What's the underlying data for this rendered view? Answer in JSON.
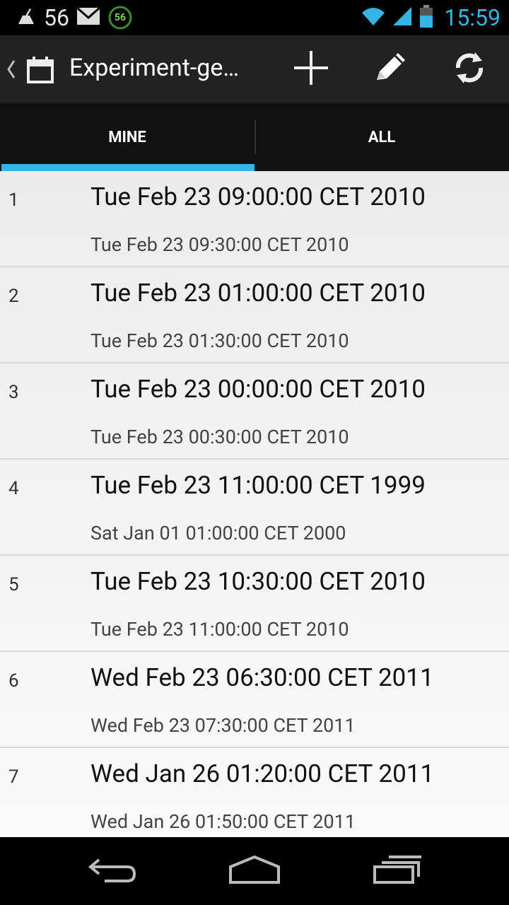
{
  "status_bar": {
    "notification_count": "56",
    "badge_count": "56",
    "time": "15:59",
    "icons": [
      "cleaner-icon",
      "mail-icon",
      "badge-icon",
      "wifi-icon",
      "signal-icon",
      "battery-icon"
    ]
  },
  "action_bar": {
    "title": "Experiment-ge…",
    "icons": [
      "up-chevron-icon",
      "calendar-icon",
      "add-icon",
      "edit-icon",
      "refresh-icon"
    ]
  },
  "tabs": [
    {
      "label": "MINE",
      "selected": true
    },
    {
      "label": "ALL",
      "selected": false
    }
  ],
  "colors": {
    "accent": "#33b5e5",
    "action_bar": "#222222",
    "tabs": "#111111"
  },
  "list": [
    {
      "index": "1",
      "primary": "Tue Feb 23 09:00:00 CET 2010",
      "secondary": "Tue Feb 23 09:30:00 CET 2010"
    },
    {
      "index": "2",
      "primary": "Tue Feb 23 01:00:00 CET 2010",
      "secondary": "Tue Feb 23 01:30:00 CET 2010"
    },
    {
      "index": "3",
      "primary": "Tue Feb 23 00:00:00 CET 2010",
      "secondary": "Tue Feb 23 00:30:00 CET 2010"
    },
    {
      "index": "4",
      "primary": "Tue Feb 23 11:00:00 CET 1999",
      "secondary": "Sat Jan 01 01:00:00 CET 2000"
    },
    {
      "index": "5",
      "primary": "Tue Feb 23 10:30:00 CET 2010",
      "secondary": "Tue Feb 23 11:00:00 CET 2010"
    },
    {
      "index": "6",
      "primary": "Wed Feb 23 06:30:00 CET 2011",
      "secondary": "Wed Feb 23 07:30:00 CET 2011"
    },
    {
      "index": "7",
      "primary": "Wed Jan 26 01:20:00 CET 2011",
      "secondary": "Wed Jan 26 01:50:00 CET 2011"
    }
  ],
  "nav_bar": {
    "icons": [
      "back-icon",
      "home-icon",
      "recents-icon"
    ]
  }
}
